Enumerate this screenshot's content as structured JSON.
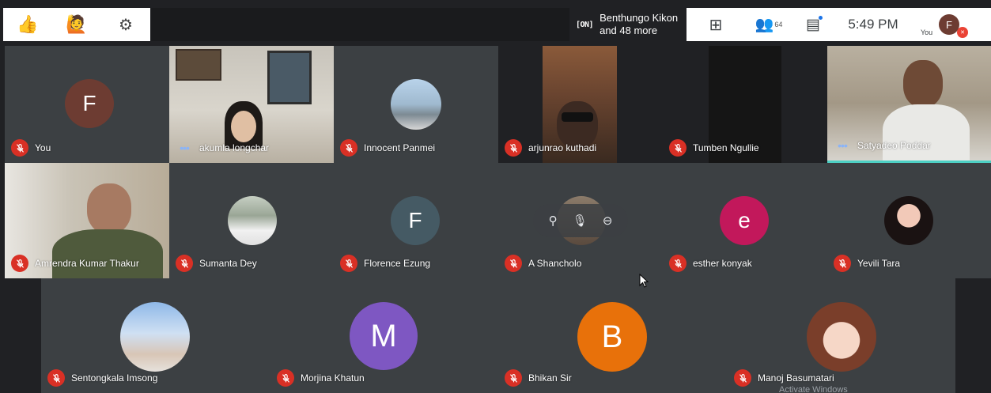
{
  "topbar": {
    "reactions": [
      {
        "icon": "thumbs-up-icon",
        "glyph": "👍"
      },
      {
        "icon": "raise-hand-icon",
        "glyph": "🙋"
      },
      {
        "icon": "gear-icon",
        "glyph": "⚙"
      }
    ],
    "presentation": {
      "indicator": "[ON]",
      "line1": "Benthungo Kikon",
      "line2": "and 48 more"
    },
    "grid_icon": "⊞",
    "people_icon": "👥",
    "people_count": "64",
    "chat_icon": "▤",
    "time": "5:49 PM",
    "self_label": "You",
    "self_initial": "F",
    "colors": {
      "accent": "#1a73e8",
      "muted": "#ea4335"
    }
  },
  "participants": [
    {
      "name": "You",
      "status": "muted",
      "avatar": "F",
      "avatar_color": "#6d3c32"
    },
    {
      "name": "akumla longchar",
      "status": "speaking"
    },
    {
      "name": "Innocent Panmei",
      "status": "muted"
    },
    {
      "name": "arjunrao kuthadi",
      "status": "muted"
    },
    {
      "name": "Tumben Ngullie",
      "status": "muted"
    },
    {
      "name": "Satyadeo Poddar",
      "status": "speaking"
    },
    {
      "name": "Amrendra Kumar Thakur",
      "status": "muted"
    },
    {
      "name": "Sumanta Dey",
      "status": "muted"
    },
    {
      "name": "Florence Ezung",
      "status": "muted",
      "avatar": "F",
      "avatar_color": "#455a64"
    },
    {
      "name": "A Shancholo",
      "status": "muted"
    },
    {
      "name": "esther konyak",
      "status": "muted",
      "avatar": "e",
      "avatar_color": "#c2185b"
    },
    {
      "name": "Yevili Tara",
      "status": "muted"
    },
    {
      "name": "Sentongkala Imsong",
      "status": "muted"
    },
    {
      "name": "Morjina Khatun",
      "status": "muted",
      "avatar": "M",
      "avatar_color": "#7e57c2"
    },
    {
      "name": "Bhikan Sir",
      "status": "muted",
      "avatar": "B",
      "avatar_color": "#e8710a"
    },
    {
      "name": "Manoj Basumatari",
      "status": "muted"
    }
  ],
  "hover_controls": [
    {
      "icon": "pin-icon",
      "glyph": "⚲"
    },
    {
      "icon": "mic-off-icon",
      "glyph": "🎙"
    },
    {
      "icon": "remove-icon",
      "glyph": "⊖"
    }
  ],
  "watermark": "Activate Windows"
}
